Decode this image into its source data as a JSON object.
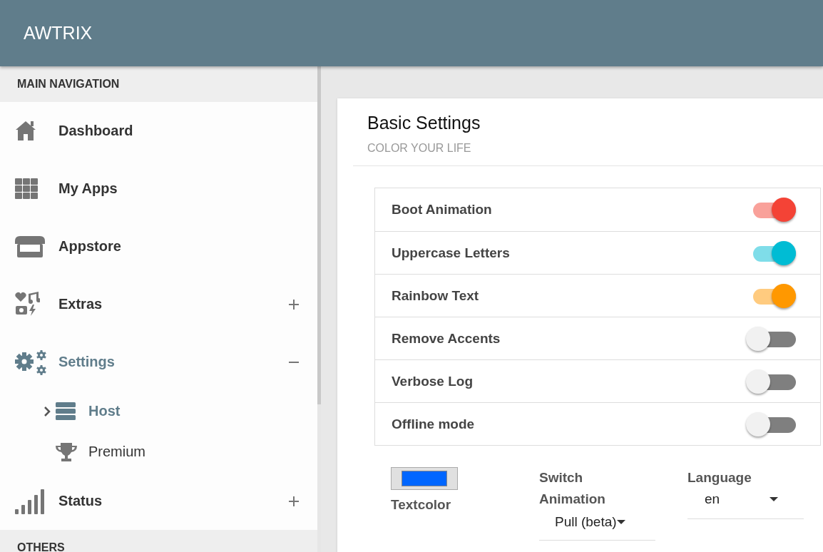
{
  "app_bar": {
    "title": "AWTRIX"
  },
  "sidebar": {
    "header": "MAIN NAVIGATION",
    "items": [
      {
        "label": "Dashboard",
        "selected": false
      },
      {
        "label": "My Apps",
        "selected": false
      },
      {
        "label": "Appstore",
        "selected": false
      },
      {
        "label": "Extras",
        "selected": false,
        "expanded": false
      },
      {
        "label": "Settings",
        "selected": true,
        "expanded": true,
        "children": [
          {
            "label": "Host",
            "selected": true
          },
          {
            "label": "Premium",
            "selected": false
          }
        ]
      },
      {
        "label": "Status",
        "selected": false,
        "expanded": false
      }
    ],
    "footer_header": "OTHERS"
  },
  "card": {
    "title": "Basic Settings",
    "subtitle": "COLOR YOUR LIFE",
    "toggles": [
      {
        "label": "Boot Animation",
        "on": true,
        "color": "#f44336"
      },
      {
        "label": "Uppercase Letters",
        "on": true,
        "color": "#00bcd4"
      },
      {
        "label": "Rainbow Text",
        "on": true,
        "color": "#ff9800"
      },
      {
        "label": "Remove Accents",
        "on": false
      },
      {
        "label": "Verbose Log",
        "on": false
      },
      {
        "label": "Offline mode",
        "on": false
      }
    ],
    "textcolor": {
      "label": "Textcolor",
      "color": "#0066ff"
    },
    "switch_animation": {
      "label": "Switch Animation",
      "value": "Pull (beta)"
    },
    "language": {
      "label": "Language",
      "value": "en"
    }
  }
}
